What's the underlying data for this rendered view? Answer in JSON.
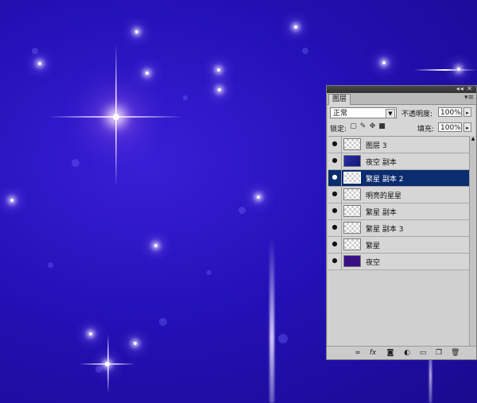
{
  "panel": {
    "tab_label": "图层",
    "titlebar_icons": "◂◂ ✕",
    "tab_menu": "▾≡"
  },
  "blend": {
    "mode": "正常",
    "arrow": "▼"
  },
  "opacity": {
    "label": "不透明度:",
    "value": "100%",
    "stepper": "▸"
  },
  "lock": {
    "label": "锁定:",
    "icons": [
      "lock-transparent-icon",
      "brush-icon",
      "move-icon",
      "lock-icon"
    ]
  },
  "fill": {
    "label": "填充:",
    "value": "100%",
    "stepper": "▸"
  },
  "layers": [
    {
      "name": "图层 3",
      "thumb": "transparent",
      "selected": false
    },
    {
      "name": "夜空 副本",
      "thumb": "night-copy",
      "selected": false
    },
    {
      "name": "繁星 副本 2",
      "thumb": "transparent",
      "selected": true
    },
    {
      "name": "明亮的星星",
      "thumb": "transparent",
      "selected": false
    },
    {
      "name": "繁星 副本",
      "thumb": "transparent",
      "selected": false
    },
    {
      "name": "繁星 副本 3",
      "thumb": "transparent",
      "selected": false
    },
    {
      "name": "繁星",
      "thumb": "transparent",
      "selected": false
    },
    {
      "name": "夜空",
      "thumb": "night",
      "selected": false
    }
  ],
  "bottom_icons": [
    "link-icon",
    "fx-icon",
    "mask-icon",
    "adjustment-icon",
    "group-icon",
    "new-layer-icon",
    "trash-icon"
  ],
  "colors": {
    "background": "#2411b8",
    "selected_row": "#0b2c6e"
  }
}
